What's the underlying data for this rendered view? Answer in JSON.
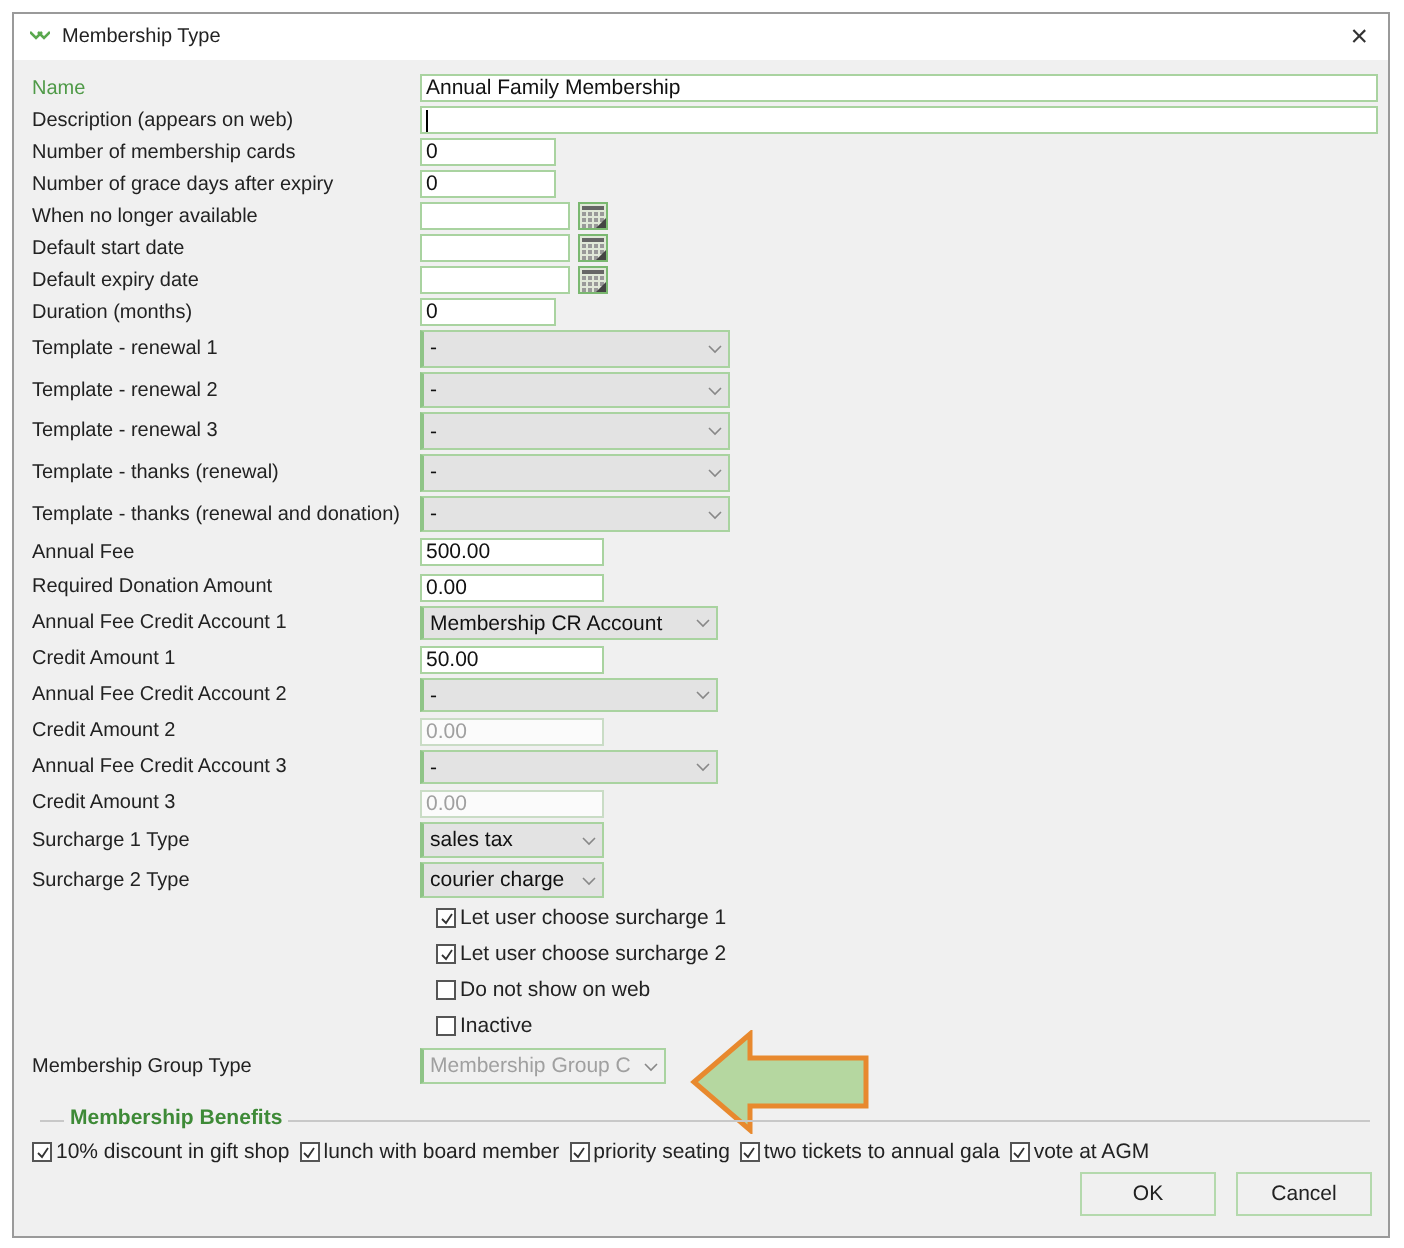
{
  "window": {
    "title": "Membership Type",
    "close": "×"
  },
  "fields": [
    {
      "label": "Name",
      "kind": "wide",
      "value": "Annual Family Membership",
      "highlighted": true,
      "disabled": false
    },
    {
      "label": "Description (appears on web)",
      "kind": "wide",
      "highlighted": false,
      "disabled": false
    },
    {
      "label": "Number of membership cards",
      "kind": "short",
      "value": "0",
      "highlighted": false,
      "disabled": false
    },
    {
      "label": "Number of grace days after expiry",
      "kind": "short",
      "value": "0",
      "highlighted": false,
      "disabled": false
    },
    {
      "label": "When no longer available",
      "kind": "date",
      "highlighted": false,
      "disabled": false
    },
    {
      "label": "Default start date",
      "kind": "date",
      "highlighted": false,
      "disabled": false
    },
    {
      "label": "Default expiry date",
      "kind": "date",
      "highlighted": false,
      "disabled": false
    },
    {
      "label": "Duration (months)",
      "kind": "short",
      "value": "0",
      "highlighted": false,
      "disabled": false
    },
    {
      "label": "Template - renewal 1",
      "kind": "template",
      "value": "-",
      "highlighted": false,
      "disabled": false
    },
    {
      "label": "Template - renewal 2",
      "kind": "template",
      "value": "-",
      "highlighted": false,
      "disabled": false
    },
    {
      "label": "Template - renewal 3",
      "kind": "template",
      "value": "-",
      "highlighted": false,
      "disabled": false
    },
    {
      "label": "Template - thanks (renewal)",
      "kind": "template",
      "value": "-",
      "highlighted": false,
      "disabled": false
    },
    {
      "label": "Template - thanks (renewal and donation)",
      "kind": "template",
      "value": "-",
      "highlighted": false,
      "disabled": false
    },
    {
      "label": "Annual Fee",
      "kind": "amount",
      "value": "500.00",
      "highlighted": false,
      "disabled": false
    },
    {
      "label": "Required Donation Amount",
      "kind": "amount",
      "value": "0.00",
      "highlighted": false,
      "disabled": false
    },
    {
      "label": "Annual Fee Credit Account 1",
      "kind": "account",
      "value": "Membership CR Account",
      "highlighted": false,
      "disabled": false
    },
    {
      "label": "Credit Amount 1",
      "kind": "amount",
      "value": "50.00",
      "highlighted": false,
      "disabled": false
    },
    {
      "label": "Annual Fee Credit Account 2",
      "kind": "account",
      "value": "-",
      "highlighted": false,
      "disabled": false
    },
    {
      "label": "Credit Amount 2",
      "kind": "amount",
      "value": "0.00",
      "highlighted": false,
      "disabled": true
    },
    {
      "label": "Annual Fee Credit Account 3",
      "kind": "account",
      "value": "-",
      "highlighted": false,
      "disabled": false
    },
    {
      "label": "Credit Amount 3",
      "kind": "amount",
      "value": "0.00",
      "highlighted": false,
      "disabled": true
    },
    {
      "label": "Surcharge 1 Type",
      "kind": "charge",
      "value": "sales tax",
      "highlighted": false,
      "disabled": false
    },
    {
      "label": "Surcharge 2 Type",
      "kind": "charge",
      "value": "courier charge",
      "highlighted": false,
      "disabled": false
    }
  ],
  "options": [
    {
      "label": "Let user choose surcharge 1",
      "checked": true
    },
    {
      "label": "Let user choose surcharge 2",
      "checked": true
    },
    {
      "label": "Do not show on web",
      "checked": false
    },
    {
      "label": "Inactive",
      "checked": false
    }
  ],
  "group_type": {
    "label": "Membership Group Type",
    "value": "Membership Group C",
    "disabled": true
  },
  "benefits": {
    "title": "Membership Benefits",
    "items": [
      {
        "label": "10% discount in gift shop",
        "checked": true
      },
      {
        "label": "lunch with board member",
        "checked": true
      },
      {
        "label": "priority seating",
        "checked": true
      },
      {
        "label": "two tickets to annual gala",
        "checked": true
      },
      {
        "label": "vote at AGM",
        "checked": true
      }
    ]
  },
  "buttons": [
    "OK",
    "Cancel"
  ]
}
